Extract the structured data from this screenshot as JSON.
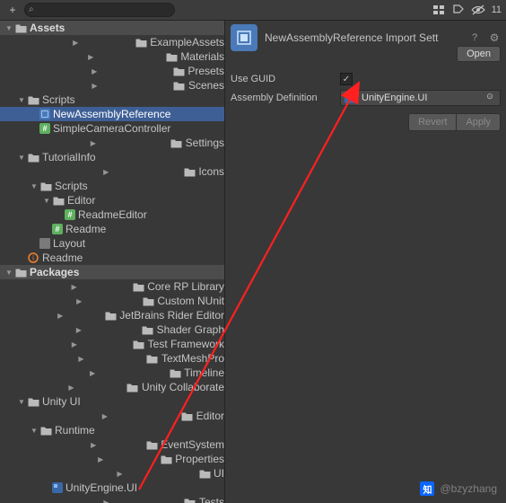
{
  "toolbar": {
    "search_placeholder": "",
    "visibility_count": "11"
  },
  "tree": {
    "assets_header": "Assets",
    "items": [
      {
        "depth": 1,
        "arrow": "right",
        "icon": "folder",
        "label": "ExampleAssets"
      },
      {
        "depth": 1,
        "arrow": "right",
        "icon": "folder",
        "label": "Materials"
      },
      {
        "depth": 1,
        "arrow": "right",
        "icon": "folder",
        "label": "Presets"
      },
      {
        "depth": 1,
        "arrow": "right",
        "icon": "folder",
        "label": "Scenes"
      },
      {
        "depth": 1,
        "arrow": "down",
        "icon": "folder",
        "label": "Scripts"
      },
      {
        "depth": 2,
        "arrow": "none",
        "icon": "asmref",
        "label": "NewAssemblyReference",
        "selected": true
      },
      {
        "depth": 2,
        "arrow": "none",
        "icon": "script",
        "label": "SimpleCameraController"
      },
      {
        "depth": 1,
        "arrow": "right",
        "icon": "folder",
        "label": "Settings"
      },
      {
        "depth": 1,
        "arrow": "down",
        "icon": "folder",
        "label": "TutorialInfo"
      },
      {
        "depth": 2,
        "arrow": "right",
        "icon": "folder",
        "label": "Icons"
      },
      {
        "depth": 2,
        "arrow": "down",
        "icon": "folder",
        "label": "Scripts"
      },
      {
        "depth": 3,
        "arrow": "down",
        "icon": "folder",
        "label": "Editor"
      },
      {
        "depth": 4,
        "arrow": "none",
        "icon": "script",
        "label": "ReadmeEditor"
      },
      {
        "depth": 3,
        "arrow": "none",
        "icon": "script",
        "label": "Readme"
      },
      {
        "depth": 2,
        "arrow": "none",
        "icon": "layout",
        "label": "Layout"
      },
      {
        "depth": 1,
        "arrow": "none",
        "icon": "readme",
        "label": "Readme"
      }
    ],
    "packages_header": "Packages",
    "packages": [
      {
        "depth": 1,
        "arrow": "right",
        "icon": "folder",
        "label": "Core RP Library"
      },
      {
        "depth": 1,
        "arrow": "right",
        "icon": "folder",
        "label": "Custom NUnit"
      },
      {
        "depth": 1,
        "arrow": "right",
        "icon": "folder",
        "label": "JetBrains Rider Editor"
      },
      {
        "depth": 1,
        "arrow": "right",
        "icon": "folder",
        "label": "Shader Graph"
      },
      {
        "depth": 1,
        "arrow": "right",
        "icon": "folder",
        "label": "Test Framework"
      },
      {
        "depth": 1,
        "arrow": "right",
        "icon": "folder",
        "label": "TextMeshPro"
      },
      {
        "depth": 1,
        "arrow": "right",
        "icon": "folder",
        "label": "Timeline"
      },
      {
        "depth": 1,
        "arrow": "right",
        "icon": "folder",
        "label": "Unity Collaborate"
      },
      {
        "depth": 1,
        "arrow": "down",
        "icon": "folder",
        "label": "Unity UI"
      },
      {
        "depth": 2,
        "arrow": "right",
        "icon": "folder",
        "label": "Editor"
      },
      {
        "depth": 2,
        "arrow": "down",
        "icon": "folder",
        "label": "Runtime"
      },
      {
        "depth": 3,
        "arrow": "right",
        "icon": "folder",
        "label": "EventSystem"
      },
      {
        "depth": 3,
        "arrow": "right",
        "icon": "folder",
        "label": "Properties"
      },
      {
        "depth": 3,
        "arrow": "right",
        "icon": "folder",
        "label": "UI"
      },
      {
        "depth": 3,
        "arrow": "none",
        "icon": "asmdef",
        "label": "UnityEngine.UI"
      },
      {
        "depth": 2,
        "arrow": "right",
        "icon": "folder",
        "label": "Tests"
      }
    ]
  },
  "inspector": {
    "title": "NewAssemblyReference Import Sett",
    "open_label": "Open",
    "use_guid_label": "Use GUID",
    "use_guid_checked": true,
    "asm_def_label": "Assembly Definition",
    "asm_def_value": "UnityEngine.UI",
    "revert_label": "Revert",
    "apply_label": "Apply"
  },
  "watermark": {
    "text": "@bzyzhang"
  }
}
